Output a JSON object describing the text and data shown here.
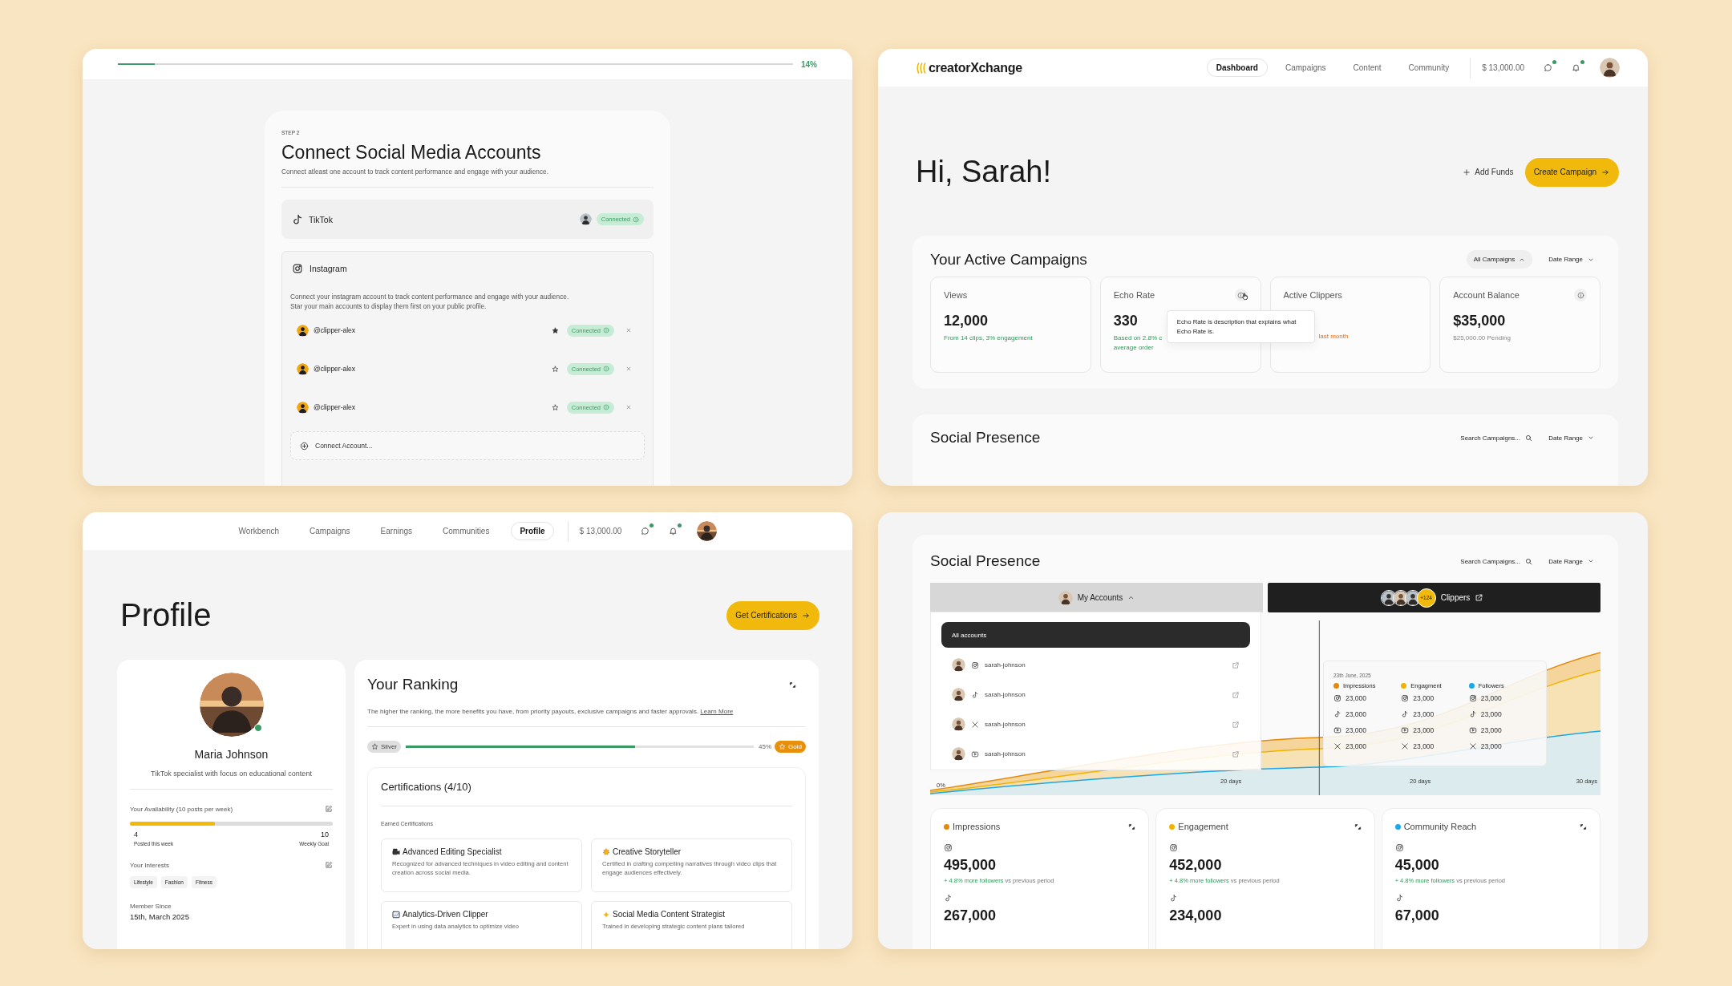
{
  "onboarding": {
    "progress": {
      "level": 0.055,
      "reading": "14%"
    },
    "step": "STEP 2",
    "title": "Connect Social Media Accounts",
    "subtitle": "Connect atleast one account to track content performance and engage with your audience.",
    "tiktok": {
      "kind": "tiktok",
      "name": "TikTok",
      "status": "Connected"
    },
    "instagram": {
      "kind": "instagram",
      "name": "Instagram",
      "description": [
        "Connect your instagram account to track content performance and engage with your audience.",
        "Star your main accounts to display them first on your public profile."
      ],
      "accounts": [
        {
          "handle": "@clipper-alex",
          "starred": true,
          "status": "Connected"
        },
        {
          "handle": "@clipper-alex",
          "starred": false,
          "status": "Connected"
        },
        {
          "handle": "@clipper-alex",
          "starred": false,
          "status": "Connected"
        }
      ],
      "connect_label": "Connect Account..."
    }
  },
  "dashboard": {
    "logo": "creatorXchange",
    "nav": [
      {
        "label": "Dashboard",
        "selected": true
      },
      {
        "label": "Campaigns",
        "selected": false
      },
      {
        "label": "Content",
        "selected": false
      },
      {
        "label": "Community",
        "selected": false
      }
    ],
    "balance": "$ 13,000.00",
    "messages_unread": true,
    "notifications_unread": true,
    "greeting": "Hi, Sarah!",
    "add_funds": "Add Funds",
    "create_campaign": "Create Campaign",
    "campaigns": {
      "title": "Your Active Campaigns",
      "filter": "All Campaigns",
      "date_range": "Date Range",
      "stats": [
        {
          "label": "Views",
          "value": "12,000",
          "note": [
            "From 14 clips, 3% engagement"
          ],
          "kind": "positive",
          "info": false,
          "hovered": false
        },
        {
          "label": "Echo Rate",
          "value": "330",
          "note": [
            "Based on 2.8% c",
            "average order"
          ],
          "kind": "positive",
          "info": true,
          "hovered": true,
          "tooltip": "Echo Rate is description that explains what Echo Rate is."
        },
        {
          "label": "Active Clippers",
          "note": [
            "last month"
          ],
          "kind": "warning",
          "info": false,
          "hovered": false
        },
        {
          "label": "Account Balance",
          "value": "$35,000",
          "note": [
            "$25,000.00 Pending"
          ],
          "kind": "neutral",
          "info": true,
          "hovered": false
        }
      ]
    },
    "social": {
      "title": "Social Presence",
      "search_placeholder": "Search Campaigns...",
      "date_range": "Date Range"
    }
  },
  "profile_page": {
    "nav": [
      {
        "label": "Workbench",
        "selected": false
      },
      {
        "label": "Campaigns",
        "selected": false
      },
      {
        "label": "Earnings",
        "selected": false
      },
      {
        "label": "Communities",
        "selected": false
      },
      {
        "label": "Profile",
        "selected": true
      }
    ],
    "balance": "$ 13,000.00",
    "messages_unread": true,
    "notifications_unread": true,
    "title": "Profile",
    "cta": "Get Certifications",
    "user": {
      "name": "Maria Johnson",
      "bio": "TikTok specialist with focus on educational content",
      "online": true,
      "availability": {
        "label": "Your Availability (10 posts per week)",
        "level": 0.42,
        "current": "4",
        "current_label": "Posted this week",
        "goal": "10",
        "goal_label": "Weekly Goal"
      },
      "interests": {
        "label": "Your Interests",
        "tags": [
          "Lifestyle",
          "Fashion",
          "Fitness"
        ]
      },
      "member_since": {
        "label": "Member Since",
        "value": "15th, March 2025"
      }
    },
    "ranking": {
      "title": "Your Ranking",
      "description": "The higher the ranking, the more benefits you have, from priority payouts, exclusive campaigns and faster approvals.",
      "link": "Learn More",
      "from": "Silver",
      "to": "Gold",
      "level": 0.66,
      "reading": "45%",
      "certifications": {
        "title": "Certifications (4/10)",
        "subtitle": "Earned Certifications",
        "items": [
          {
            "kind": "camera",
            "title": "Advanced Editing Specialist",
            "description": "Recognized for advanced techniques in video editing and content creation across social media."
          },
          {
            "kind": "burst",
            "title": "Creative Storyteller",
            "description": "Certified in crafting compelling narratives through video clips that engage audiences effectively."
          },
          {
            "kind": "chart",
            "title": "Analytics-Driven Clipper",
            "description": "Expert in using data analytics to optimize video"
          },
          {
            "kind": "sparkle",
            "title": "Social Media Content Strategist",
            "description": "Trained in developing strategic content plans tailored"
          }
        ]
      }
    }
  },
  "social_presence": {
    "title": "Social Presence",
    "search_placeholder": "Search Campaigns...",
    "date_range": "Date Range",
    "accounts_tab": {
      "label": "My Accounts",
      "expanded": true
    },
    "clippers_tab": {
      "label": "Clippers",
      "count": "+124"
    },
    "accounts_menu": [
      {
        "label": "All accounts",
        "selected": true
      },
      {
        "label": "sarah-johnson",
        "kind": "instagram",
        "selected": false
      },
      {
        "label": "sarah-johnson",
        "kind": "tiktok",
        "selected": false
      },
      {
        "label": "sarah-johnson",
        "kind": "x",
        "selected": false
      },
      {
        "label": "sarah-johnson",
        "kind": "youtube",
        "selected": false
      }
    ],
    "x_labels": [
      "0%",
      "20 days",
      "20 days",
      "30 days"
    ],
    "tooltip": {
      "date": "23th June, 2025",
      "series": [
        {
          "name": "Impressions",
          "color": "#e38a0b",
          "values": [
            {
              "kind": "instagram",
              "value": "23,000"
            },
            {
              "kind": "tiktok",
              "value": "23,000"
            },
            {
              "kind": "youtube",
              "value": "23,000"
            },
            {
              "kind": "x",
              "value": "23,000"
            }
          ]
        },
        {
          "name": "Engagment",
          "color": "#f0b400",
          "values": [
            {
              "kind": "instagram",
              "value": "23,000"
            },
            {
              "kind": "tiktok",
              "value": "23,000"
            },
            {
              "kind": "youtube",
              "value": "23,000"
            },
            {
              "kind": "x",
              "value": "23,000"
            }
          ]
        },
        {
          "name": "Followers",
          "color": "#1ea7e8",
          "values": [
            {
              "kind": "instagram",
              "value": "23,000"
            },
            {
              "kind": "tiktok",
              "value": "23,000"
            },
            {
              "kind": "youtube",
              "value": "23,000"
            },
            {
              "kind": "x",
              "value": "23,000"
            }
          ]
        }
      ]
    },
    "metrics": [
      {
        "title": "Impressions",
        "color": "#e38a0b",
        "rows": [
          {
            "kind": "instagram",
            "value": "495,000",
            "change": "+ 4.8% more followers",
            "suffix": "vs previous period"
          },
          {
            "kind": "tiktok",
            "value": "267,000"
          }
        ]
      },
      {
        "title": "Engagement",
        "color": "#f0b400",
        "rows": [
          {
            "kind": "instagram",
            "value": "452,000",
            "change": "+ 4.8% more followers",
            "suffix": "vs previous period"
          },
          {
            "kind": "tiktok",
            "value": "234,000"
          }
        ]
      },
      {
        "title": "Community Reach",
        "color": "#1ea7e8",
        "rows": [
          {
            "kind": "instagram",
            "value": "45,000",
            "change": "+ 4.8% more followers",
            "suffix": "vs previous period"
          },
          {
            "kind": "tiktok",
            "value": "67,000"
          }
        ]
      }
    ]
  }
}
